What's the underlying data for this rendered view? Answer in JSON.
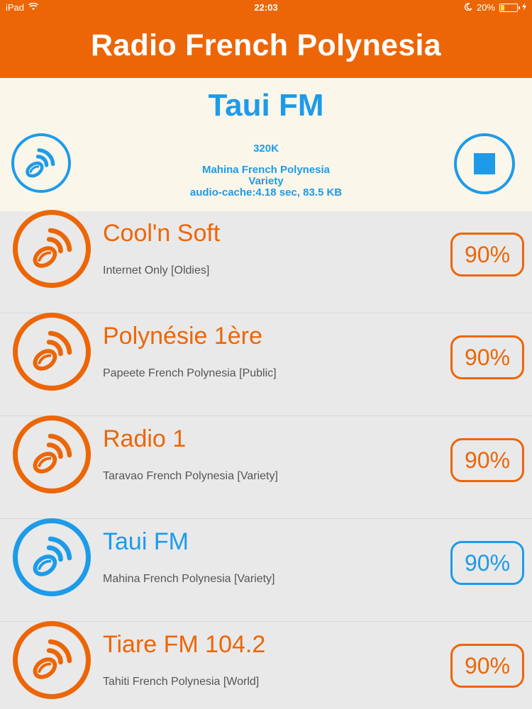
{
  "status_bar": {
    "device": "iPad",
    "time": "22:03",
    "battery": "20%"
  },
  "header": {
    "title": "Radio French Polynesia"
  },
  "now_playing": {
    "station": "Taui FM",
    "bitrate": "320K",
    "location": "Mahina French Polynesia",
    "genre": "Variety",
    "cache": "audio-cache:4.18 sec, 83.5 KB",
    "icon": "radio-speaker-icon"
  },
  "stations": [
    {
      "name": "Cool'n Soft",
      "desc": "Internet Only [Oldies]",
      "badge": "90%",
      "active": false
    },
    {
      "name": "Polynésie 1ère",
      "desc": "Papeete French Polynesia [Public]",
      "badge": "90%",
      "active": false
    },
    {
      "name": "Radio 1",
      "desc": "Taravao French Polynesia [Variety]",
      "badge": "90%",
      "active": false
    },
    {
      "name": "Taui FM",
      "desc": "Mahina French Polynesia [Variety]",
      "badge": "90%",
      "active": true
    },
    {
      "name": "Tiare FM 104.2",
      "desc": "Tahiti French Polynesia [World]",
      "badge": "90%",
      "active": false
    }
  ],
  "colors": {
    "orange": "#ec6607",
    "blue": "#1d9be9",
    "panel": "#faf6ea",
    "list_bg": "#e9e9e9"
  }
}
